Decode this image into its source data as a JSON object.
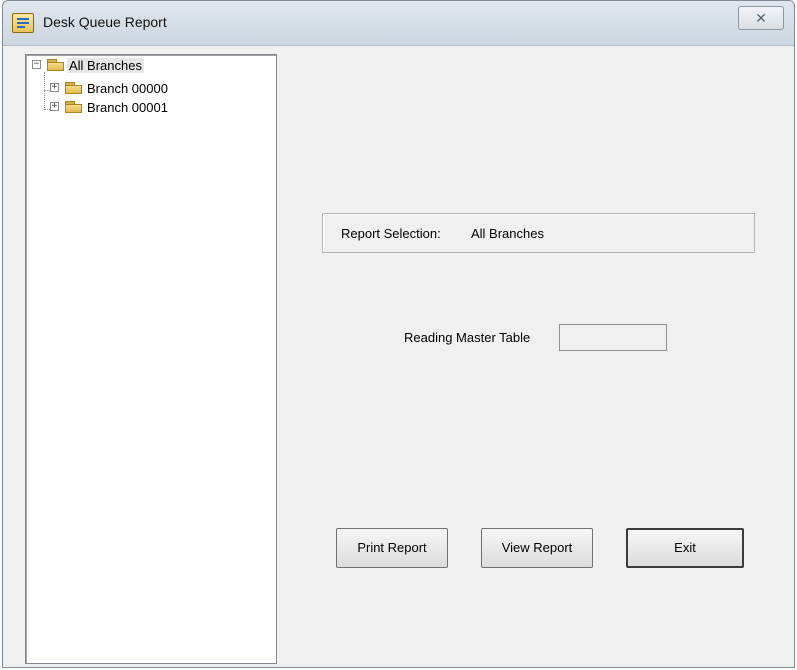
{
  "window": {
    "title": "Desk Queue Report",
    "close_glyph": "✕"
  },
  "tree": {
    "root": {
      "label": "All Branches",
      "expander": "−",
      "icon": "folder-icon"
    },
    "children": [
      {
        "label": "Branch 00000",
        "expander": "+",
        "icon": "folder-icon"
      },
      {
        "label": "Branch 00001",
        "expander": "+",
        "icon": "folder-icon"
      }
    ]
  },
  "report_selection": {
    "label": "Report Selection:",
    "value": "All Branches"
  },
  "reading": {
    "label": "Reading Master Table",
    "value": ""
  },
  "buttons": {
    "print": "Print Report",
    "view": "View Report",
    "exit": "Exit"
  }
}
